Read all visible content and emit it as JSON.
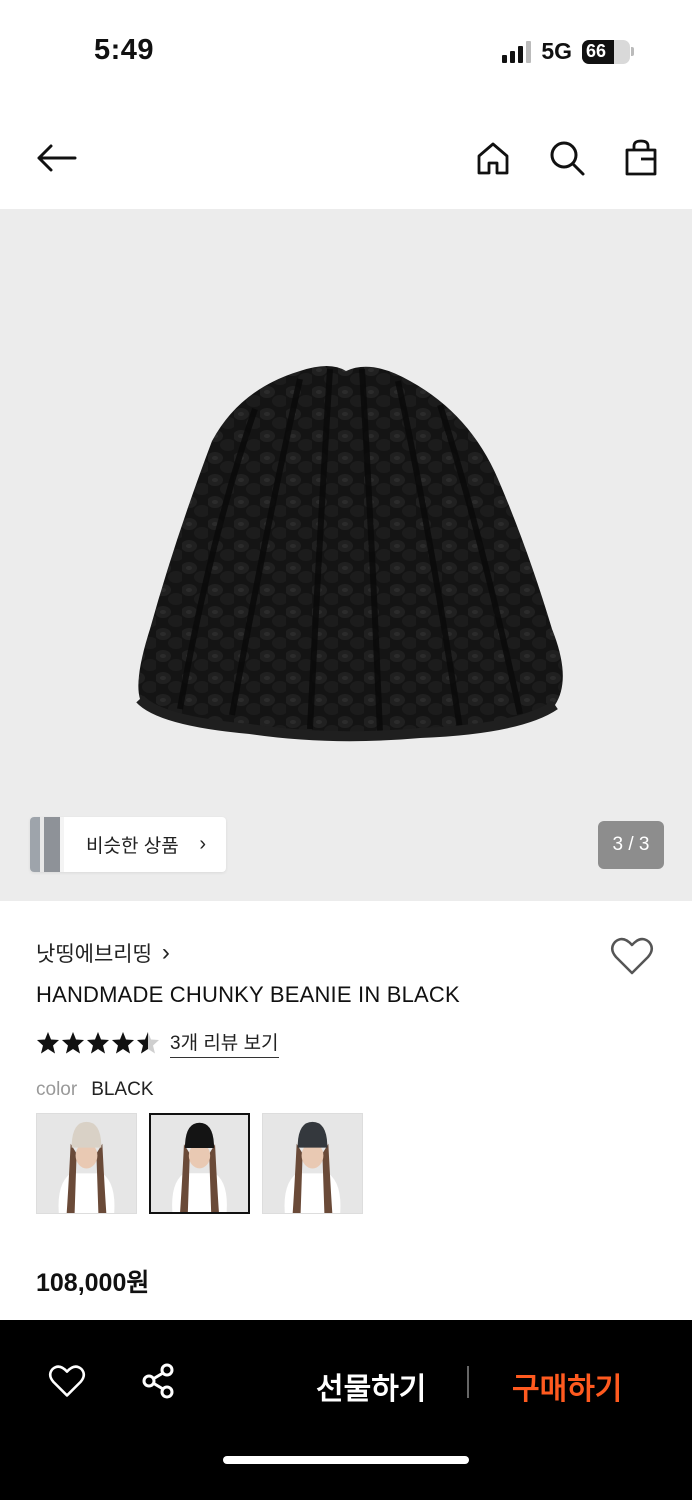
{
  "status_bar": {
    "time": "5:49",
    "network": "5G",
    "battery": "66",
    "battery_level": 0.66
  },
  "nav": {
    "back_icon": "arrow-left-icon",
    "home_icon": "home-icon",
    "search_icon": "search-icon",
    "bag_icon": "shopping-bag-icon"
  },
  "gallery": {
    "similar_label": "비슷한 상품",
    "similar_chevron": "›",
    "counter": "3 / 3"
  },
  "product": {
    "brand": "낫띵에브리띵",
    "brand_chevron": "›",
    "title": "HANDMADE CHUNKY BEANIE IN BLACK",
    "rating": 4.5,
    "review_link": "3개 리뷰 보기",
    "color_label": "color",
    "color_value": "BLACK",
    "swatches": [
      {
        "name": "ivory",
        "hat_color": "#d9d1c6",
        "selected": false
      },
      {
        "name": "black",
        "hat_color": "#141414",
        "selected": true
      },
      {
        "name": "charcoal",
        "hat_color": "#34383d",
        "selected": false
      }
    ],
    "price": "108,000원"
  },
  "bottom_bar": {
    "wish_icon": "heart-icon",
    "share_icon": "share-icon",
    "gift_label": "선물하기",
    "buy_label": "구매하기"
  },
  "colors": {
    "accent": "#ff5a1f",
    "hero_bg": "#ececec",
    "bottom_bar_bg": "#000000"
  }
}
